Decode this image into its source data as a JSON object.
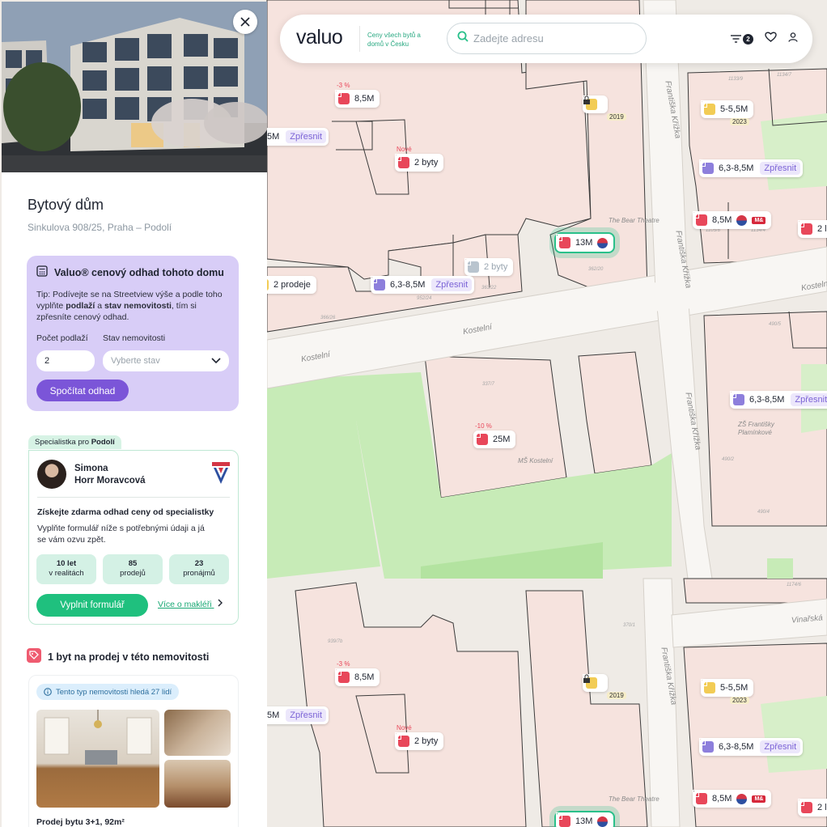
{
  "header": {
    "logo": "valuo",
    "tagline": "Ceny všech bytů a domů v Česku",
    "search_placeholder": "Zadejte adresu",
    "filter_count": "2"
  },
  "panel": {
    "title": "Bytový dům",
    "address": "Sinkulova 908/25, Praha – Podolí",
    "estimate": {
      "heading": "Valuo® cenový odhad tohoto domu",
      "tip_prefix": "Tip: Podívejte se na Streetview výše a podle toho vyplňte ",
      "tip_bold1": "podlaží",
      "tip_mid": " a ",
      "tip_bold2": "stav nemovitosti",
      "tip_suffix": ", tím si zpřesníte cenový odhad.",
      "floors_label": "Počet podlaží",
      "floors_value": "2",
      "state_label": "Stav nemovitosti",
      "state_placeholder": "Vyberte stav",
      "button": "Spočítat odhad"
    },
    "specialist": {
      "tab_prefix": "Specialistka pro",
      "tab_area": "Podolí",
      "first_name": "Simona",
      "last_name": "Horr Moravcová",
      "headline": "Získejte zdarma odhad ceny od specialistky",
      "desc": "Vyplňte formulář níže s potřebnými údaji a já se vám ozvu zpět.",
      "stats": [
        {
          "value": "10 let",
          "label": "v realitách"
        },
        {
          "value": "85",
          "label": "prodejů"
        },
        {
          "value": "23",
          "label": "pronájmů"
        }
      ],
      "button": "Vyplnit formulář",
      "more_link": "Více o makléři"
    },
    "for_sale": {
      "heading": "1 byt na prodej v této nemovitosti",
      "demand": "Tento typ nemovitosti hledá 27 lidí",
      "listing_title": "Prodej bytu 3+1, 92m²"
    }
  },
  "map": {
    "streets": {
      "kostelni": "Kostelní",
      "krizka": "Františka Křížka",
      "vinarska": "Vinařská",
      "bear": "The Bear Theatre",
      "ms": "MŠ Kostelní",
      "zs": "ZŠ Františky Plamínkové"
    },
    "markers": {
      "m1": {
        "tag": "-3 %",
        "price": "8,5M"
      },
      "m2": {
        "tag": "Nové",
        "price": "2 byty"
      },
      "m3": {
        "price": "5M",
        "refine": "Zpřesnit"
      },
      "m4": {
        "sub": "2019"
      },
      "m5": {
        "price": "5-5,5M",
        "sub": "2023"
      },
      "m6": {
        "price": "6,3-8,5M",
        "refine": "Zpřesnit"
      },
      "m7": {
        "price": "8,5M"
      },
      "m8": {
        "price": "2 l"
      },
      "m9": {
        "price": "13M"
      },
      "m10": {
        "price": "2 byty"
      },
      "m11": {
        "price": "2 prodeje"
      },
      "m12": {
        "price": "6,3-8,5M",
        "refine": "Zpřesnit"
      },
      "m13": {
        "price": "6,3-8,5M",
        "refine": "Zpřesnit"
      },
      "m14": {
        "tag": "-10 %",
        "price": "25M"
      },
      "b1": {
        "tag": "-3 %",
        "price": "8,5M"
      },
      "b2": {
        "tag": "Nové",
        "price": "2 byty"
      },
      "b3": {
        "price": "5M",
        "refine": "Zpřesnit"
      },
      "b4": {
        "sub": "2019"
      },
      "b5": {
        "price": "5-5,5M",
        "sub": "2023"
      },
      "b6": {
        "price": "6,3-8,5M",
        "refine": "Zpřesnit"
      },
      "b7": {
        "price": "8,5M"
      },
      "b8": {
        "price": "2 l"
      },
      "b9": {
        "price": "13M"
      }
    },
    "house_numbers": [
      "1133/9",
      "1134/7",
      "1105/6",
      "1134/4",
      "362/20",
      "363/22",
      "952/24",
      "366/26",
      "337/7",
      "490/5",
      "490/2",
      "490/4",
      "939/7b",
      "370/1",
      "1174/6"
    ]
  },
  "colors": {
    "accent": "#27c08a",
    "purple": "#7b55d8",
    "red": "#e8475a"
  }
}
